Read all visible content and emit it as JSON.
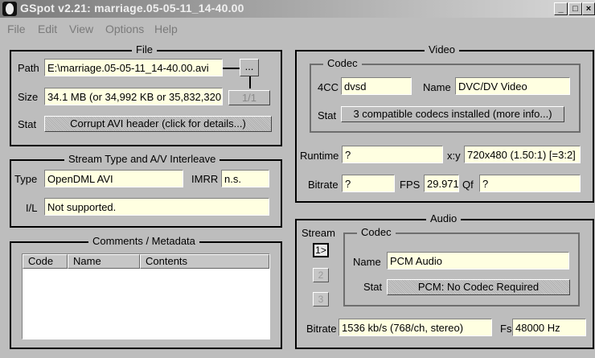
{
  "window": {
    "title": "GSpot v2.21: marriage.05-05-11_14-40.00",
    "controls": [
      "_",
      "□",
      "×"
    ]
  },
  "menu": [
    "File",
    "Edit",
    "View",
    "Options",
    "Help"
  ],
  "file": {
    "title": "File",
    "path_label": "Path",
    "path_value": "E:\\marriage.05-05-11_14-40.00.avi",
    "browse_label": "...",
    "size_label": "Size",
    "size_value": "34.1 MB (or 34,992 KB or 35,832,320",
    "part_label": "1/1",
    "stat_label": "Stat",
    "stat_value": "Corrupt AVI header (click for details...)"
  },
  "stream": {
    "title": "Stream Type and A/V Interleave",
    "type_label": "Type",
    "type_value": "OpenDML AVI",
    "imrr_label": "IMRR",
    "imrr_value": "n.s.",
    "il_label": "I/L",
    "il_value": "Not supported."
  },
  "comments": {
    "title": "Comments / Metadata",
    "columns": [
      "Code",
      "Name",
      "Contents"
    ]
  },
  "video": {
    "title": "Video",
    "codec_title": "Codec",
    "fourcc_label": "4CC",
    "fourcc_value": "dvsd",
    "name_label": "Name",
    "name_value": "DVC/DV Video",
    "stat_label": "Stat",
    "stat_value": "3 compatible codecs installed (more info...)",
    "runtime_label": "Runtime",
    "runtime_value": "?",
    "xy_label": "x:y",
    "xy_value": "720x480 (1.50:1) [=3:2]",
    "bitrate_label": "Bitrate",
    "bitrate_value": "?",
    "fps_label": "FPS",
    "fps_value": "29.971",
    "qf_label": "Qf",
    "qf_value": "?"
  },
  "audio": {
    "title": "Audio",
    "stream_label": "Stream",
    "codec_title": "Codec",
    "stream_buttons": [
      "1>",
      "2",
      "3"
    ],
    "name_label": "Name",
    "name_value": "PCM Audio",
    "stat_label": "Stat",
    "stat_value": "PCM: No Codec Required",
    "bitrate_label": "Bitrate",
    "bitrate_value": "1536 kb/s (768/ch, stereo)",
    "fs_label": "Fs",
    "fs_value": "48000 Hz"
  }
}
